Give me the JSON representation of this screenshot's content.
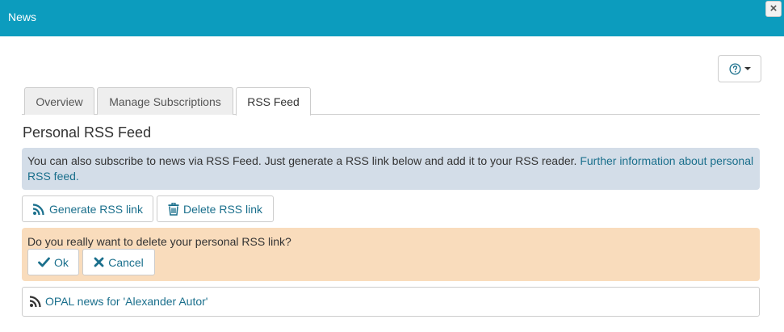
{
  "window": {
    "title": "News",
    "close_glyph": "×"
  },
  "help": {
    "icon": "question-circle-icon"
  },
  "tabs": [
    {
      "label": "Overview"
    },
    {
      "label": "Manage Subscriptions"
    },
    {
      "label": "RSS Feed",
      "active": true
    }
  ],
  "section": {
    "title": "Personal RSS Feed"
  },
  "info": {
    "text": "You can also subscribe to news via RSS Feed. Just generate a RSS link below and add it to your RSS reader.",
    "link_text": "Further information about personal RSS feed."
  },
  "actions": {
    "generate_label": "Generate RSS link",
    "delete_label": "Delete RSS link"
  },
  "confirm": {
    "question": "Do you really want to delete your personal RSS link?",
    "ok_label": "Ok",
    "cancel_label": "Cancel"
  },
  "feed": {
    "label": "OPAL news for 'Alexander Autor'"
  },
  "colors": {
    "header": "#0c9cbe",
    "link": "#1a6f8c",
    "info_bg": "#d3dde8",
    "warning_bg": "#f9dcbc"
  }
}
